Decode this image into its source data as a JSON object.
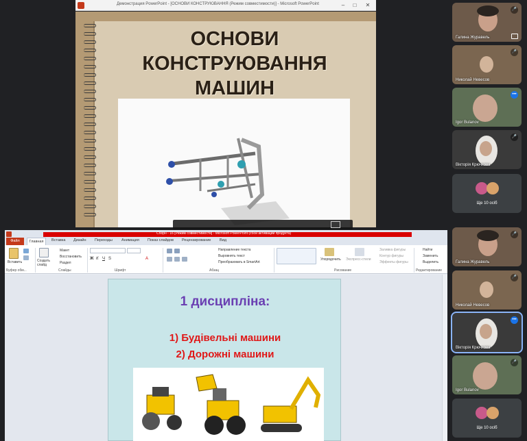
{
  "top_window": {
    "title": "Демонстрация PowerPoint - [ОСНОВИ КОНСТРУЮВАННЯ (Режим совместимости)] - Microsoft PowerPoint",
    "slide": {
      "title_line1": "ОСНОВИ",
      "title_line2": "КОНСТРУЮВАННЯ",
      "title_line3": "МАШИН"
    }
  },
  "bottom_window": {
    "title": "Сборн - 16 [Режим совместимости] - Microsoft PowerPoint (сбой активации продукта)",
    "tabs": [
      "Файл",
      "Главная",
      "Вставка",
      "Дизайн",
      "Переходы",
      "Анимация",
      "Показ слайдов",
      "Рецензирование",
      "Вид"
    ],
    "ribbon": {
      "paste": "Вставить",
      "new_slide": "Создать слайд",
      "layout": "Макет",
      "reset": "Восстановить",
      "section": "Раздел",
      "text_direction": "Направление текста",
      "align_text": "Выровнять текст",
      "smartart": "Преобразовать в SmartArt",
      "arrange": "Упорядочить",
      "quick_styles": "Экспресс-стили",
      "shape_fill": "Заливка фигуры",
      "shape_outline": "Контур фигуры",
      "shape_effects": "Эффекты фигуры",
      "find": "Найти",
      "replace": "Заменить",
      "select": "Выделить",
      "groups": {
        "clipboard": "Буфер обм...",
        "slides": "Слайды",
        "font": "Шрифт",
        "paragraph": "Абзац",
        "drawing": "Рисование",
        "editing": "Редактирование"
      }
    },
    "slide": {
      "discipline": "1 дисципліна:",
      "item1": "1)   Будівельні машини",
      "item2": "2) Дорожні машини"
    }
  },
  "participants": [
    {
      "name": "Галина Журавель"
    },
    {
      "name": "Николай Невесов"
    },
    {
      "name": "Igor Bulanov"
    },
    {
      "name": "Вікторія Крючкова"
    },
    {
      "more": "Ще 10 осіб"
    },
    {
      "name": "Галина Журавель"
    },
    {
      "name": "Николай Невесов"
    },
    {
      "name": "Вікторія Крючкова"
    },
    {
      "name": "Igor Bulanov"
    },
    {
      "more": "Ще 10 осіб"
    }
  ],
  "colors": {
    "ppt_red": "#c4391a",
    "active_speaker": "#1a73e8",
    "slide_purple": "#6a3fb2",
    "slide_red": "#e01818"
  }
}
